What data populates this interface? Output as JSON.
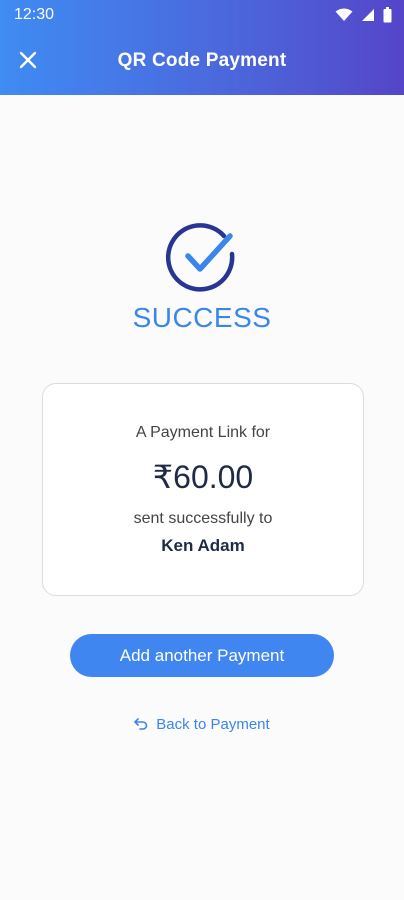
{
  "status_bar": {
    "time": "12:30"
  },
  "header": {
    "title": "QR Code Payment"
  },
  "result": {
    "status_text": "SUCCESS"
  },
  "card": {
    "line1": "A Payment Link for",
    "amount": "₹60.00",
    "line2": "sent successfully to",
    "recipient": "Ken Adam"
  },
  "actions": {
    "primary_label": "Add another Payment",
    "back_label": "Back to Payment"
  },
  "colors": {
    "accent": "#3a86ec",
    "header_gradient_start": "#3f8cf3",
    "header_gradient_end": "#5545c8",
    "check_ring": "#283593"
  },
  "icons": {
    "close": "close-icon",
    "check": "check-circle-icon",
    "back": "back-arrow-icon",
    "wifi": "wifi-icon",
    "signal": "signal-icon",
    "battery": "battery-icon"
  }
}
